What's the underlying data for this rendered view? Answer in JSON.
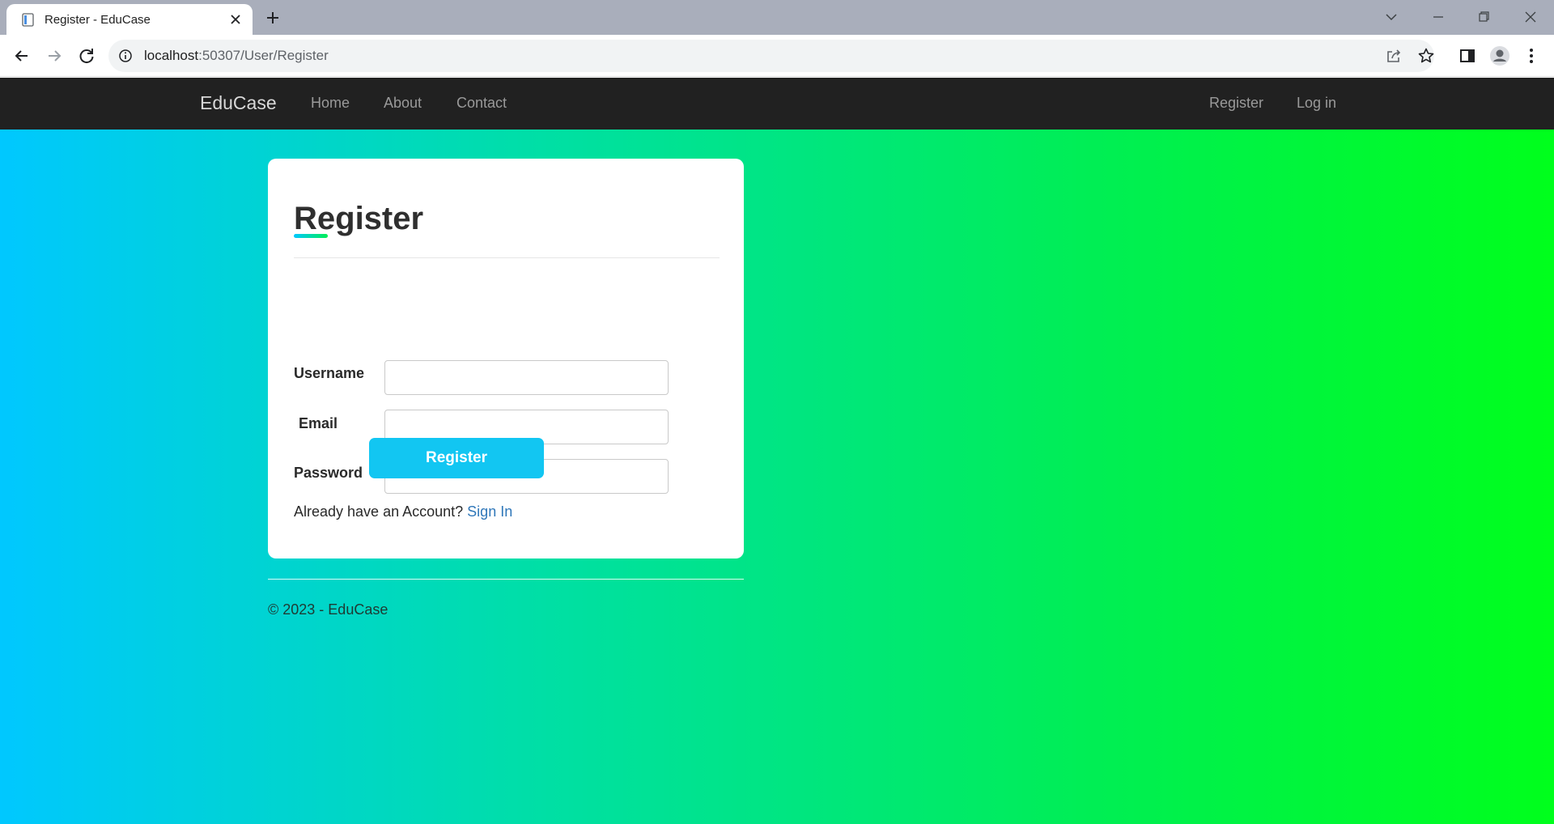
{
  "browser": {
    "tab": {
      "title": "Register - EduCase",
      "favicon": "page-icon",
      "close_icon": "close-icon"
    },
    "new_tab_icon": "plus-icon",
    "window_controls": [
      "chevron-down-icon",
      "minimize-icon",
      "restore-icon",
      "close-icon"
    ],
    "toolbar": {
      "back_icon": "arrow-left-icon",
      "forward_icon": "arrow-right-icon",
      "reload_icon": "reload-icon",
      "site_info_icon": "info-icon",
      "url_host": "localhost",
      "url_rest": ":50307/User/Register",
      "share_icon": "share-icon",
      "bookmark_icon": "star-icon",
      "sidepanel_icon": "side-panel-icon",
      "profile_icon": "avatar-icon",
      "menu_icon": "kebab-menu-icon"
    }
  },
  "navbar": {
    "brand": "EduCase",
    "left_links": [
      "Home",
      "About",
      "Contact"
    ],
    "right_links": [
      "Register",
      "Log in"
    ]
  },
  "form": {
    "title": "Register",
    "fields": [
      {
        "label": "Username",
        "value": ""
      },
      {
        "label": "Email",
        "value": ""
      },
      {
        "label": "Password",
        "value": ""
      }
    ],
    "submit_label": "Register",
    "already_text": "Already have an Account?",
    "signin_link": "Sign In"
  },
  "footer": {
    "text": "© 2023 - EduCase"
  },
  "colors": {
    "navbar_bg": "#212121",
    "gradient_start": "#00c8ff",
    "gradient_end": "#00ff1c",
    "button_bg": "#12c6f2",
    "link": "#2f77b9"
  }
}
